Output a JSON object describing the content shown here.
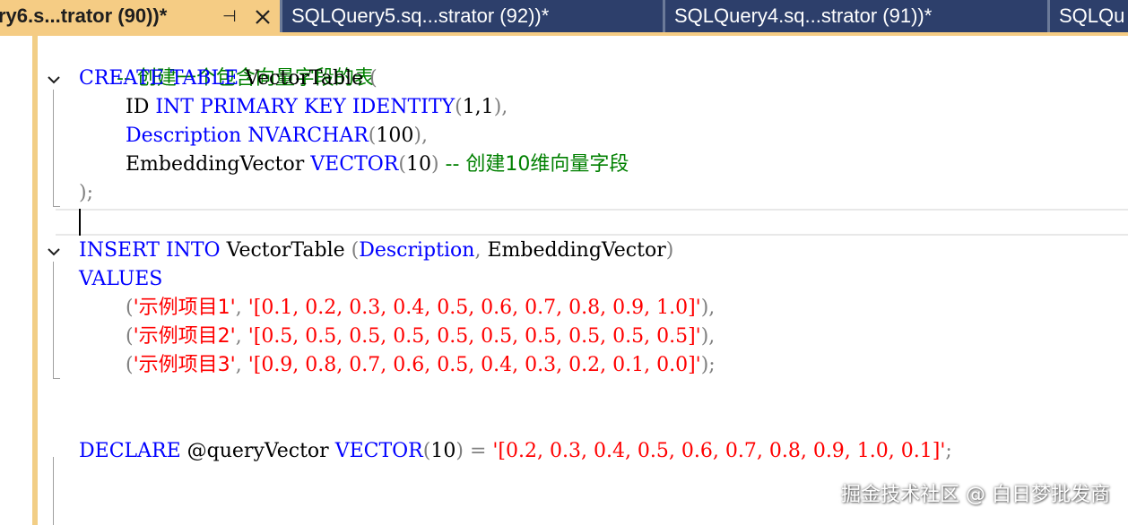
{
  "tabs": [
    {
      "label": "ry6.s...trator (90))*",
      "active": true,
      "pin_glyph": "⊣"
    },
    {
      "label": "SQLQuery5.sq...strator (92))*",
      "active": false
    },
    {
      "label": "SQLQuery4.sq...strator (91))*",
      "active": false
    },
    {
      "label": "SQLQu",
      "active": false
    }
  ],
  "colors": {
    "tab_active": "#f5cc84",
    "tab_inactive": "#2d3f6b",
    "keyword": "#0000ff",
    "comment": "#008000",
    "string": "#ff0000",
    "punct": "#808080"
  },
  "code": {
    "l1": {
      "comment": "-- 创建一个包含向量字段的表"
    },
    "l2": {
      "kw1": "CREATE",
      "kw2": "TABLE",
      "name": "VectorTable",
      "paren": "("
    },
    "l3": {
      "col": "ID",
      "kw1": "INT",
      "kw2": "PRIMARY",
      "kw3": "KEY",
      "kw4": "IDENTITY",
      "p1": "(",
      "args": "1,1",
      "p2": "),"
    },
    "l4": {
      "kw1": "Description",
      "kw2": "NVARCHAR",
      "p1": "(",
      "num": "100",
      "p2": "),"
    },
    "l5": {
      "col": "EmbeddingVector",
      "kw1": "VECTOR",
      "p1": "(",
      "num": "10",
      "p2": ")",
      "comment": "-- 创建10维向量字段"
    },
    "l6": {
      "end": ");"
    },
    "l8": {
      "kw1": "INSERT",
      "kw2": "INTO",
      "name": "VectorTable",
      "p1": "(",
      "c1": "Description",
      "comma": ",",
      "c2": "EmbeddingVector",
      "p2": ")"
    },
    "l9": {
      "kw": "VALUES"
    },
    "l10": {
      "p1": "(",
      "s1": "'示例项目1'",
      "comma": ",",
      "s2": "'[0.1, 0.2, 0.3, 0.4, 0.5, 0.6, 0.7, 0.8, 0.9, 1.0]'",
      "p2": "),"
    },
    "l11": {
      "p1": "(",
      "s1": "'示例项目2'",
      "comma": ",",
      "s2": "'[0.5, 0.5, 0.5, 0.5, 0.5, 0.5, 0.5, 0.5, 0.5, 0.5]'",
      "p2": "),"
    },
    "l12": {
      "p1": "(",
      "s1": "'示例项目3'",
      "comma": ",",
      "s2": "'[0.9, 0.8, 0.7, 0.6, 0.5, 0.4, 0.3, 0.2, 0.1, 0.0]'",
      "p2": ");"
    },
    "l15": {
      "kw1": "DECLARE",
      "var": "@queryVector",
      "kw2": "VECTOR",
      "p1": "(",
      "num": "10",
      "p2": ")",
      "eq": "=",
      "s": "'[0.2, 0.3, 0.4, 0.5, 0.6, 0.7, 0.8, 0.9, 1.0, 0.1]'",
      "end": ";"
    }
  },
  "watermark": "掘金技术社区 @ 白日梦批发商"
}
